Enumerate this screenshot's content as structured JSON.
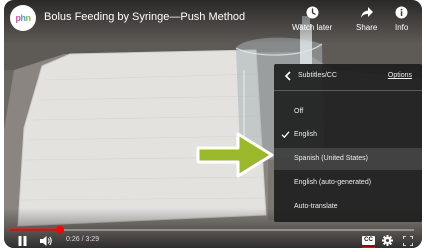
{
  "video": {
    "title": "Bolus Feeding by Syringe—Push Method",
    "channel_logo_letters": [
      "p",
      "h",
      "n"
    ],
    "channel_logo_colors": [
      "#e84c9b",
      "#37a6e0",
      "#7fbf3f"
    ]
  },
  "top_actions": [
    {
      "label": "Watch later",
      "icon": "clock-icon"
    },
    {
      "label": "Share",
      "icon": "share-arrow-icon"
    },
    {
      "label": "Info",
      "icon": "info-icon"
    }
  ],
  "subtitles_menu": {
    "title": "Subtitles/CC",
    "options_label": "Options",
    "items": [
      {
        "label": "Off",
        "selected": false,
        "highlighted": false
      },
      {
        "label": "English",
        "selected": true,
        "highlighted": false
      },
      {
        "label": "Spanish (United States)",
        "selected": false,
        "highlighted": true
      },
      {
        "label": "English (auto-generated)",
        "selected": false,
        "highlighted": false
      },
      {
        "label": "Auto-translate",
        "selected": false,
        "highlighted": false
      }
    ]
  },
  "player": {
    "time_display": "0:26 / 3:29",
    "progress_fraction": 0.124,
    "cc_label": "CC",
    "play_state": "playing",
    "accent_color": "#ff0000",
    "pointer_arrow_color": "#9bb82b"
  }
}
